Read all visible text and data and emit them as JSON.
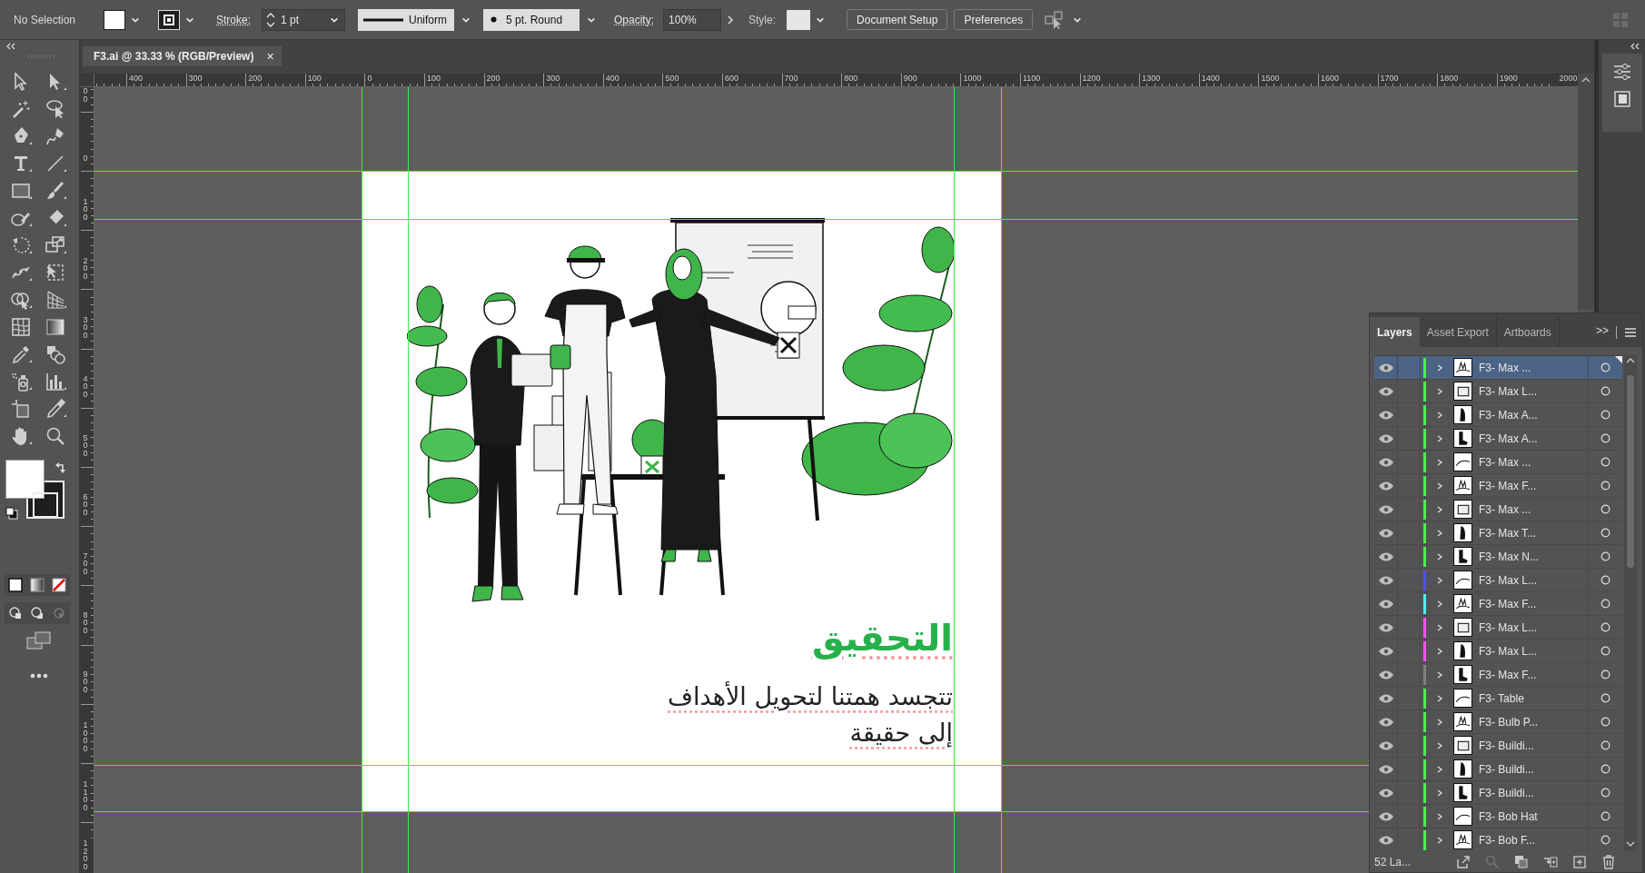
{
  "control_bar": {
    "selection": "No Selection",
    "stroke_label": "Stroke:",
    "stroke_weight": "1 pt",
    "stroke_profile": "Uniform",
    "brush": "5 pt. Round",
    "opacity_label": "Opacity:",
    "opacity": "100%",
    "style_label": "Style:",
    "buttons": [
      "Document Setup",
      "Preferences"
    ]
  },
  "document_tab": {
    "title": "F3.ai @ 33.33 % (RGB/Preview)",
    "close": "×",
    "selected": true
  },
  "rulers": {
    "horizontal": [
      "400",
      "300",
      "200",
      "100",
      "0",
      "100",
      "200",
      "300",
      "400",
      "500",
      "600",
      "700",
      "800",
      "900",
      "1000",
      "1100",
      "1200",
      "1300",
      "1400",
      "1500",
      "1600",
      "1700",
      "1800",
      "1900",
      "2000"
    ],
    "vertical": [
      "00",
      "0",
      "100",
      "200",
      "300",
      "400",
      "500",
      "600",
      "700",
      "800",
      "900",
      "1000",
      "1100",
      "1200"
    ]
  },
  "artboard": {
    "title": {
      "text": "التحقيق",
      "spell_flagged": true
    },
    "body_lines": [
      {
        "text": "تتجسد همتنا لتحويل الأهداف",
        "spell_flagged": true
      },
      {
        "text": "إلى حقيقة",
        "spell_flagged": true
      }
    ]
  },
  "layers_panel": {
    "tabs": [
      {
        "label": "Layers",
        "selected": true
      },
      {
        "label": "Asset Export",
        "selected": false
      },
      {
        "label": "Artboards",
        "selected": false
      }
    ],
    "overflow": ">>",
    "layers": [
      {
        "name": "F3- Max ...",
        "color": "#4cf04c",
        "visible": true,
        "expanded": false,
        "selected": true
      },
      {
        "name": "F3- Max L...",
        "color": "#4cf04c",
        "visible": true,
        "expanded": false,
        "selected": false
      },
      {
        "name": "F3- Max A...",
        "color": "#4cf04c",
        "visible": true,
        "expanded": false,
        "selected": false
      },
      {
        "name": "F3- Max A...",
        "color": "#4cf04c",
        "visible": true,
        "expanded": false,
        "selected": false
      },
      {
        "name": "F3- Max ...",
        "color": "#4cf04c",
        "visible": true,
        "expanded": false,
        "selected": false
      },
      {
        "name": "F3- Max F...",
        "color": "#4cf04c",
        "visible": true,
        "expanded": false,
        "selected": false
      },
      {
        "name": "F3- Max ...",
        "color": "#4cf04c",
        "visible": true,
        "expanded": false,
        "selected": false
      },
      {
        "name": "F3- Max T...",
        "color": "#4cf04c",
        "visible": true,
        "expanded": false,
        "selected": false
      },
      {
        "name": "F3- Max N...",
        "color": "#4cf04c",
        "visible": true,
        "expanded": false,
        "selected": false
      },
      {
        "name": "F3- Max L...",
        "color": "#4f4fff",
        "visible": true,
        "expanded": false,
        "selected": false
      },
      {
        "name": "F3- Max F...",
        "color": "#4ff0ff",
        "visible": true,
        "expanded": false,
        "selected": false
      },
      {
        "name": "F3- Max L...",
        "color": "#ff4fff",
        "visible": true,
        "expanded": false,
        "selected": false
      },
      {
        "name": "F3- Max L...",
        "color": "#ff4fff",
        "visible": true,
        "expanded": false,
        "selected": false
      },
      {
        "name": "F3- Max F...",
        "color": "#808080",
        "visible": true,
        "expanded": false,
        "selected": false
      },
      {
        "name": "F3- Table",
        "color": "#4cf04c",
        "visible": true,
        "expanded": false,
        "selected": false
      },
      {
        "name": "F3- Bulb P...",
        "color": "#4cf04c",
        "visible": true,
        "expanded": false,
        "selected": false
      },
      {
        "name": "F3- Buildi...",
        "color": "#4cf04c",
        "visible": true,
        "expanded": false,
        "selected": false
      },
      {
        "name": "F3- Buildi...",
        "color": "#4cf04c",
        "visible": true,
        "expanded": false,
        "selected": false
      },
      {
        "name": "F3- Buildi...",
        "color": "#4cf04c",
        "visible": true,
        "expanded": false,
        "selected": false
      },
      {
        "name": "F3- Bob Hat",
        "color": "#4cf04c",
        "visible": true,
        "expanded": false,
        "selected": false
      },
      {
        "name": "F3- Bob F...",
        "color": "#4cf04c",
        "visible": true,
        "expanded": false,
        "selected": false
      }
    ],
    "count": "52 La..."
  }
}
